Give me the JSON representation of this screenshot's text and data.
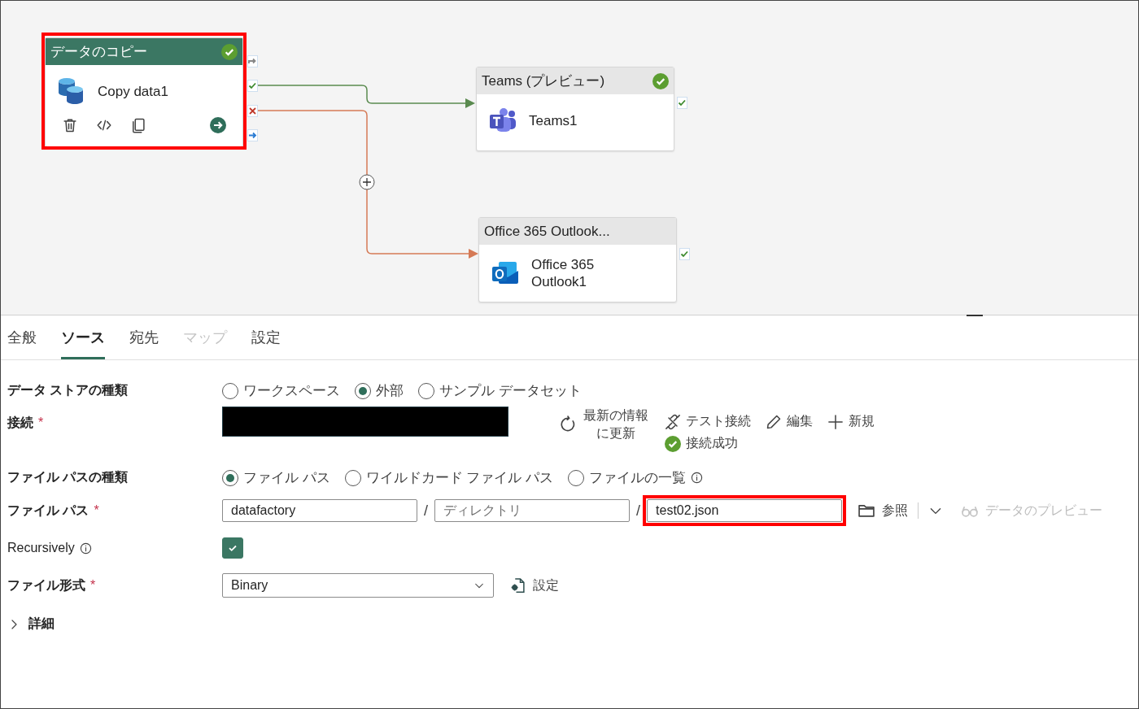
{
  "canvas": {
    "activities": [
      {
        "kind": "copy",
        "title": "データのコピー",
        "name": "Copy data1",
        "succeeded": true,
        "highlighted": true
      },
      {
        "kind": "teams",
        "title": "Teams (プレビュー)",
        "name": "Teams1",
        "succeeded": true,
        "highlighted": false
      },
      {
        "kind": "outlook",
        "title": "Office 365 Outlook...",
        "name": "Office 365 Outlook1",
        "succeeded": false,
        "highlighted": false
      }
    ],
    "connections": [
      {
        "kind": "success"
      },
      {
        "kind": "failure"
      }
    ]
  },
  "tabs": [
    {
      "label": "全般",
      "selected": false,
      "disabled": false
    },
    {
      "label": "ソース",
      "selected": true,
      "disabled": false
    },
    {
      "label": "宛先",
      "selected": false,
      "disabled": false
    },
    {
      "label": "マップ",
      "selected": false,
      "disabled": true
    },
    {
      "label": "設定",
      "selected": false,
      "disabled": false
    }
  ],
  "data_store_type": {
    "label": "データ ストアの種類",
    "options": [
      {
        "label": "ワークスペース",
        "selected": false
      },
      {
        "label": "外部",
        "selected": true
      },
      {
        "label": "サンプル データセット",
        "selected": false
      }
    ]
  },
  "connection": {
    "label": "接続",
    "required": "*",
    "refresh": "最新の情報に更新",
    "test": "テスト接続",
    "edit": "編集",
    "new": "新規",
    "status": "接続成功"
  },
  "file_path_type": {
    "label": "ファイル パスの種類",
    "options": [
      {
        "label": "ファイル パス",
        "selected": true,
        "info": false
      },
      {
        "label": "ワイルドカード ファイル パス",
        "selected": false,
        "info": false
      },
      {
        "label": "ファイルの一覧",
        "selected": false,
        "info": true
      }
    ]
  },
  "file_path": {
    "label": "ファイル パス",
    "required": "*",
    "parts": [
      {
        "kind": "input",
        "value": "datafactory",
        "highlighted": false
      },
      {
        "kind": "separator",
        "text": "/"
      },
      {
        "kind": "input",
        "placeholder": "ディレクトリ",
        "highlighted": false
      },
      {
        "kind": "separator",
        "text": "/"
      },
      {
        "kind": "input",
        "value": "test02.json",
        "highlighted": true
      }
    ],
    "browse": "参照",
    "preview": {
      "label": "データのプレビュー",
      "disabled": true
    }
  },
  "recursively": {
    "label": "Recursively",
    "checked": true
  },
  "file_format": {
    "label": "ファイル形式",
    "required": "*",
    "value": "Binary",
    "settings": "設定"
  },
  "advanced": {
    "label": "詳細",
    "expanded": false
  }
}
